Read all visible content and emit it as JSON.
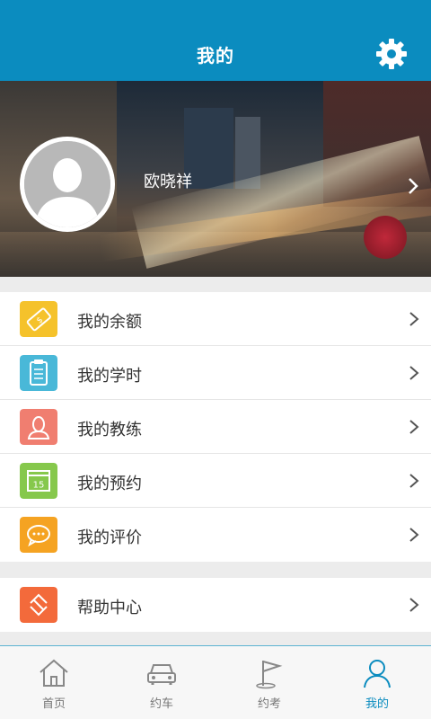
{
  "header": {
    "title": "我的",
    "settings_icon": "gear-icon"
  },
  "profile": {
    "name": "欧晓祥",
    "avatar_icon": "default-avatar-icon"
  },
  "menu_group_1": [
    {
      "label": "我的余额",
      "icon": "ticket-icon",
      "color": "#f5c22b"
    },
    {
      "label": "我的学时",
      "icon": "clipboard-icon",
      "color": "#49b8d8"
    },
    {
      "label": "我的教练",
      "icon": "person-icon",
      "color": "#f07e70"
    },
    {
      "label": "我的预约",
      "icon": "calendar-icon",
      "color": "#86c84c",
      "icon_text": "15"
    },
    {
      "label": "我的评价",
      "icon": "chat-bubble-icon",
      "color": "#f5a322"
    }
  ],
  "menu_group_2": [
    {
      "label": "帮助中心",
      "icon": "refresh-arrows-icon",
      "color": "#f36a3b"
    }
  ],
  "tabbar": {
    "active": "我的",
    "tabs": [
      {
        "label": "首页",
        "icon": "home-icon"
      },
      {
        "label": "约车",
        "icon": "car-icon"
      },
      {
        "label": "约考",
        "icon": "flag-icon"
      },
      {
        "label": "我的",
        "icon": "person-outline-icon"
      }
    ],
    "active_color": "#0b8cbf"
  },
  "colors": {
    "header": "#0b8cbf",
    "background": "#ececec"
  }
}
